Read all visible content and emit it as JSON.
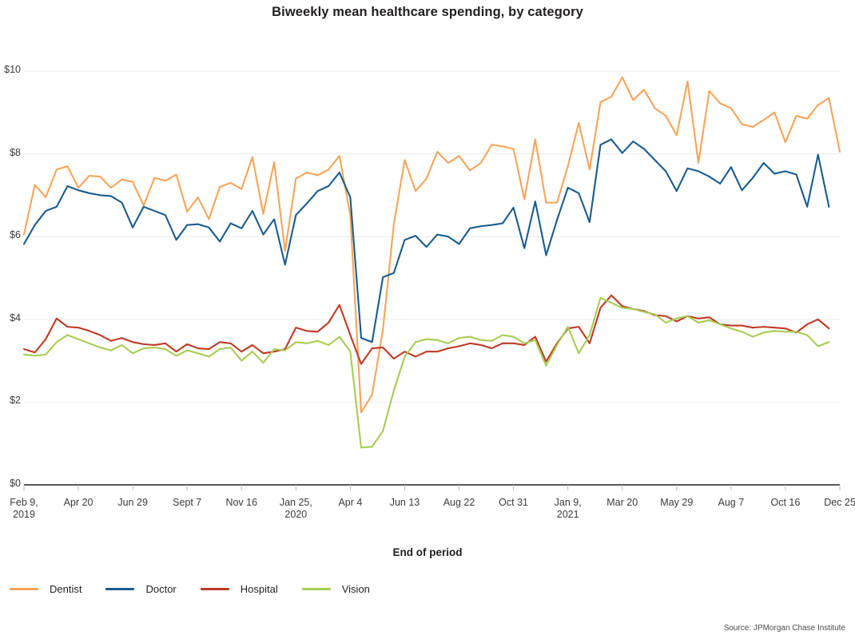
{
  "chart_data": {
    "type": "line",
    "title": "Biweekly mean healthcare spending, by category",
    "xlabel": "End of period",
    "ylabel": "",
    "ylim": [
      0,
      10
    ],
    "ytick_labels": [
      "$0",
      "$2",
      "$4",
      "$6",
      "$8",
      "$10"
    ],
    "ytick_values": [
      0,
      2,
      4,
      6,
      8,
      10
    ],
    "grid": "horizontal",
    "legend_position": "bottom-left",
    "source": "Source: JPMorgan Chase Institute",
    "xtick_labels": [
      "Feb 9,\n2019",
      "Apr 20",
      "Jun 29",
      "Sept 7",
      "Nov 16",
      "Jan 25,\n2020",
      "Apr 4",
      "Jun 13",
      "Aug 22",
      "Oct 31",
      "Jan 9,\n2021",
      "Mar 20",
      "May 29",
      "Aug 7",
      "Oct 16",
      "Dec 25"
    ],
    "xtick_indices": [
      0,
      5,
      10,
      15,
      20,
      25,
      30,
      35,
      40,
      45,
      50,
      55,
      60,
      65,
      70,
      75
    ],
    "x_count": 76,
    "series": [
      {
        "name": "Dentist",
        "color": "#F5A55A",
        "values": [
          6.05,
          7.25,
          6.95,
          7.62,
          7.7,
          7.18,
          7.47,
          7.45,
          7.18,
          7.38,
          7.32,
          6.75,
          7.42,
          7.35,
          7.5,
          6.6,
          6.95,
          6.42,
          7.2,
          7.3,
          7.15,
          7.92,
          6.55,
          7.8,
          5.65,
          7.4,
          7.55,
          7.48,
          7.62,
          7.95,
          6.52,
          1.75,
          2.18,
          3.75,
          6.3,
          7.85,
          7.1,
          7.4,
          8.05,
          7.78,
          7.95,
          7.6,
          7.78,
          8.22,
          8.18,
          8.12,
          6.9,
          8.35,
          6.82,
          6.82,
          7.7,
          8.75,
          7.62,
          9.25,
          9.38,
          9.85,
          9.3,
          9.55,
          9.1,
          8.92,
          8.45,
          9.75,
          7.78,
          9.52,
          9.22,
          9.1,
          8.72,
          8.65,
          8.82,
          9.0,
          8.28,
          8.92,
          8.85,
          9.18,
          9.35,
          8.05
        ]
      },
      {
        "name": "Doctor",
        "color": "#1A5C8E",
        "values": [
          5.82,
          6.28,
          6.62,
          6.72,
          7.22,
          7.12,
          7.05,
          7.0,
          6.98,
          6.82,
          6.22,
          6.72,
          6.62,
          6.52,
          5.92,
          6.28,
          6.3,
          6.22,
          5.88,
          6.32,
          6.2,
          6.62,
          6.05,
          6.42,
          5.32,
          6.52,
          6.8,
          7.1,
          7.22,
          7.55,
          6.95,
          3.55,
          3.45,
          5.02,
          5.12,
          5.92,
          6.02,
          5.75,
          6.05,
          6.0,
          5.82,
          6.2,
          6.25,
          6.28,
          6.32,
          6.7,
          5.72,
          6.85,
          5.55,
          6.4,
          7.18,
          7.05,
          6.35,
          8.22,
          8.35,
          8.02,
          8.3,
          8.12,
          7.85,
          7.58,
          7.1,
          7.65,
          7.58,
          7.45,
          7.28,
          7.68,
          7.12,
          7.42,
          7.78,
          7.52,
          7.58,
          7.5,
          6.72,
          7.98,
          6.72
        ]
      },
      {
        "name": "Hospital",
        "color": "#BE3A25",
        "values": [
          3.28,
          3.2,
          3.52,
          4.02,
          3.82,
          3.8,
          3.72,
          3.62,
          3.48,
          3.55,
          3.45,
          3.4,
          3.38,
          3.42,
          3.22,
          3.4,
          3.3,
          3.28,
          3.45,
          3.42,
          3.22,
          3.38,
          3.18,
          3.22,
          3.28,
          3.8,
          3.72,
          3.7,
          3.92,
          4.35,
          3.62,
          2.92,
          3.3,
          3.32,
          3.05,
          3.22,
          3.1,
          3.22,
          3.22,
          3.3,
          3.35,
          3.42,
          3.38,
          3.3,
          3.42,
          3.42,
          3.38,
          3.58,
          2.98,
          3.42,
          3.78,
          3.82,
          3.42,
          4.28,
          4.58,
          4.32,
          4.25,
          4.2,
          4.1,
          4.08,
          3.95,
          4.08,
          4.02,
          4.05,
          3.88,
          3.85,
          3.85,
          3.8,
          3.82,
          3.8,
          3.78,
          3.68,
          3.88,
          4.0,
          3.78
        ]
      },
      {
        "name": "Vision",
        "color": "#A8CC52",
        "values": [
          3.15,
          3.12,
          3.15,
          3.45,
          3.62,
          3.52,
          3.42,
          3.32,
          3.25,
          3.38,
          3.18,
          3.3,
          3.32,
          3.28,
          3.12,
          3.25,
          3.18,
          3.1,
          3.28,
          3.32,
          3.0,
          3.22,
          2.95,
          3.28,
          3.25,
          3.45,
          3.42,
          3.48,
          3.38,
          3.58,
          3.22,
          0.9,
          0.92,
          1.3,
          2.28,
          3.1,
          3.45,
          3.52,
          3.5,
          3.42,
          3.55,
          3.58,
          3.5,
          3.48,
          3.62,
          3.58,
          3.42,
          3.5,
          2.88,
          3.38,
          3.82,
          3.18,
          3.62,
          4.52,
          4.4,
          4.28,
          4.25,
          4.18,
          4.12,
          3.92,
          4.02,
          4.08,
          3.92,
          3.98,
          3.88,
          3.78,
          3.7,
          3.58,
          3.68,
          3.72,
          3.7,
          3.7,
          3.62,
          3.35,
          3.45
        ]
      }
    ]
  },
  "legend": {
    "items": [
      {
        "label": "Dentist"
      },
      {
        "label": "Doctor"
      },
      {
        "label": "Hospital"
      },
      {
        "label": "Vision"
      }
    ]
  }
}
